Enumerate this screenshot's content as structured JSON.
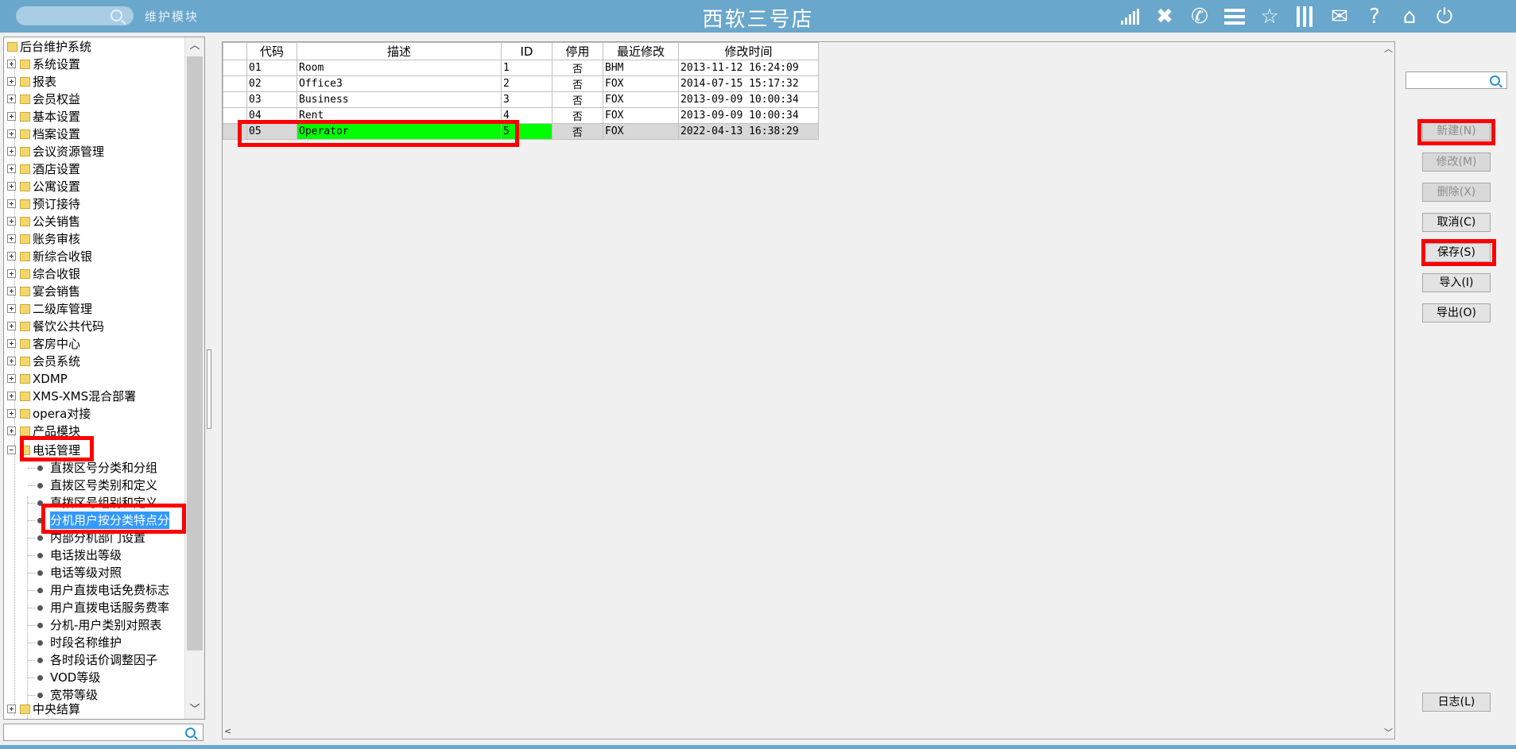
{
  "header": {
    "module_label": "维护模块",
    "store_title": "西软三号店",
    "toolbar_icons": [
      "signal-icon",
      "tools-icon",
      "phone-icon",
      "menu-icon",
      "star-icon",
      "columns-icon",
      "mail-icon",
      "help-icon",
      "home-icon",
      "power-icon"
    ]
  },
  "tree": {
    "root": "后台维护系统",
    "groups": [
      "系统设置",
      "报表",
      "会员权益",
      "基本设置",
      "档案设置",
      "会议资源管理",
      "酒店设置",
      "公寓设置",
      "预订接待",
      "公关销售",
      "账务审核",
      "新综合收银",
      "综合收银",
      "宴会销售",
      "二级库管理",
      "餐饮公共代码",
      "客房中心",
      "会员系统",
      "XDMP",
      "XMS-XMS混合部署",
      "opera对接",
      "产品模块"
    ],
    "expanded_group": "电话管理",
    "children": [
      "直拨区号分类和分组",
      "直拨区号类别和定义",
      "直拨区号组别和定义",
      "分机用户按分类特点分",
      "内部分机部门设置",
      "电话拨出等级",
      "电话等级对照",
      "用户直拨电话免费标志",
      "用户直拨电话服务费率",
      "分机-用户类别对照表",
      "时段名称维护",
      "各时段话价调整因子",
      "VOD等级",
      "宽带等级"
    ],
    "selected_child": "分机用户按分类特点分",
    "last_group": "中央结算"
  },
  "grid": {
    "columns": [
      "代码",
      "描述",
      "ID",
      "停用",
      "最近修改",
      "修改时间"
    ],
    "rows": [
      {
        "code": "01",
        "desc": "Room",
        "id": "1",
        "disabled": "否",
        "modifier": "BHM",
        "time": "2013-11-12 16:24:09"
      },
      {
        "code": "02",
        "desc": "Office3",
        "id": "2",
        "disabled": "否",
        "modifier": "FOX",
        "time": "2014-07-15 15:17:32"
      },
      {
        "code": "03",
        "desc": "Business",
        "id": "3",
        "disabled": "否",
        "modifier": "FOX",
        "time": "2013-09-09 10:00:34"
      },
      {
        "code": "04",
        "desc": "Rent",
        "id": "4",
        "disabled": "否",
        "modifier": "FOX",
        "time": "2013-09-09 10:00:34"
      },
      {
        "code": "05",
        "desc": "Operator",
        "id": "5",
        "disabled": "否",
        "modifier": "FOX",
        "time": "2022-04-13 16:38:29"
      }
    ],
    "selected_row": "05"
  },
  "buttons": {
    "new": "新建(N)",
    "modify": "修改(M)",
    "delete": "删除(X)",
    "cancel": "取消(C)",
    "save": "保存(S)",
    "import": "导入(I)",
    "export": "导出(O)",
    "log": "日志(L)"
  },
  "colors": {
    "header": "#6aa7cc",
    "selection_green": "#00ff00",
    "annotation_red": "#ff0000",
    "tree_selection": "#3399ff"
  }
}
